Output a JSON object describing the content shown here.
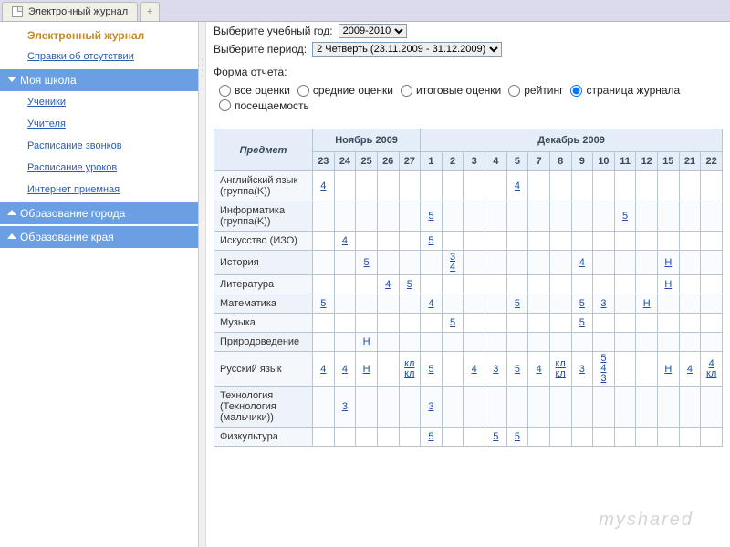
{
  "tabbar": {
    "title": "Электронный журнал",
    "plus": "+"
  },
  "sidebar": {
    "heading": "Электронный журнал",
    "topLink": "Справки об отсутствии",
    "groups": [
      {
        "label": "Моя школа",
        "expanded": true,
        "items": [
          "Ученики",
          "Учителя",
          "Расписание звонков",
          "Расписание уроков",
          "Интернет приемная"
        ]
      },
      {
        "label": "Образование города",
        "expanded": false,
        "items": []
      },
      {
        "label": "Образование края",
        "expanded": false,
        "items": []
      }
    ]
  },
  "filters": {
    "yearLabel": "Выберите учебный год:",
    "yearValue": "2009-2010",
    "periodLabel": "Выберите период:",
    "periodValue": "2 Четверть (23.11.2009 - 31.12.2009)",
    "formLabel": "Форма отчета:",
    "options": [
      "все оценки",
      "средние оценки",
      "итоговые оценки",
      "рейтинг",
      "страница журнала",
      "посещаемость"
    ],
    "selected": 4
  },
  "table": {
    "subjectHeader": "Предмет",
    "months": [
      {
        "label": "Ноябрь 2009",
        "days": [
          "23",
          "24",
          "25",
          "26",
          "27"
        ]
      },
      {
        "label": "Декабрь 2009",
        "days": [
          "1",
          "2",
          "3",
          "4",
          "5",
          "7",
          "8",
          "9",
          "10",
          "11",
          "12",
          "15",
          "21",
          "22"
        ]
      }
    ],
    "rows": [
      {
        "subject": "Английский язык (группа(K))",
        "cells": {
          "23": "4",
          "5": "4"
        }
      },
      {
        "subject": "Информатика (группа(K))",
        "cells": {
          "1": "5",
          "11": "5"
        }
      },
      {
        "subject": "Искусство (ИЗО)",
        "cells": {
          "24": "4",
          "1": "5"
        }
      },
      {
        "subject": "История",
        "cells": {
          "25": "5",
          "2": "3\n4",
          "9": "4",
          "15": "Н"
        }
      },
      {
        "subject": "Литература",
        "cells": {
          "26": "4",
          "27": "5",
          "15": "Н"
        }
      },
      {
        "subject": "Математика",
        "cells": {
          "23": "5",
          "1": "4",
          "5": "5",
          "9": "5",
          "10": "3",
          "12": "Н"
        }
      },
      {
        "subject": "Музыка",
        "cells": {
          "2": "5",
          "9": "5"
        }
      },
      {
        "subject": "Природоведение",
        "cells": {
          "25": "Н"
        }
      },
      {
        "subject": "Русский язык",
        "cells": {
          "23": "4",
          "24": "4",
          "25": "Н",
          "27": "кл\nкл",
          "1": "5",
          "3": "4",
          "4": "3",
          "5": "5",
          "7": "4",
          "8": "кл\nкл",
          "9": "3",
          "10": "5\n4\n3",
          "15": "Н",
          "21": "4",
          "22": "4\nкл"
        }
      },
      {
        "subject": "Технология (Технология (мальчики))",
        "cells": {
          "24": "3",
          "1": "3"
        }
      },
      {
        "subject": "Физкультура",
        "cells": {
          "1": "5",
          "4": "5",
          "5": "5"
        }
      }
    ]
  },
  "watermark": "myshared"
}
